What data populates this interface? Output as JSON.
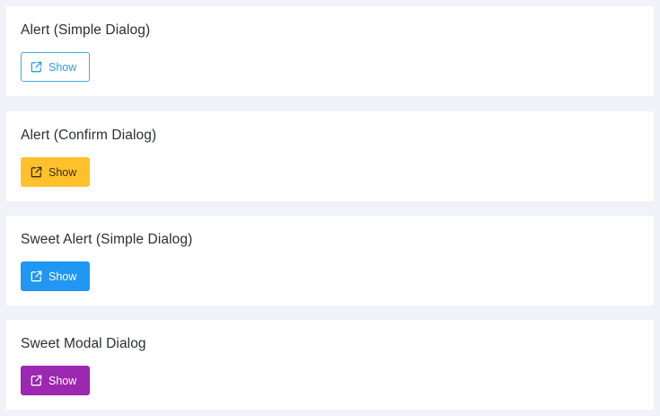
{
  "cards": [
    {
      "title": "Alert (Simple Dialog)",
      "button_label": "Show",
      "icon": "external-link-icon",
      "button_style": "outline-info",
      "button_color": "#41a9e6"
    },
    {
      "title": "Alert (Confirm Dialog)",
      "button_label": "Show",
      "icon": "external-link-icon",
      "button_style": "warning",
      "button_color": "#ffc12b"
    },
    {
      "title": "Sweet Alert (Simple Dialog)",
      "button_label": "Show",
      "icon": "external-link-icon",
      "button_style": "primary",
      "button_color": "#2196f3"
    },
    {
      "title": "Sweet Modal Dialog",
      "button_label": "Show",
      "icon": "external-link-icon",
      "button_style": "purple",
      "button_color": "#9c27b0"
    }
  ],
  "colors": {
    "background": "#eff2f7",
    "card": "#ffffff"
  }
}
